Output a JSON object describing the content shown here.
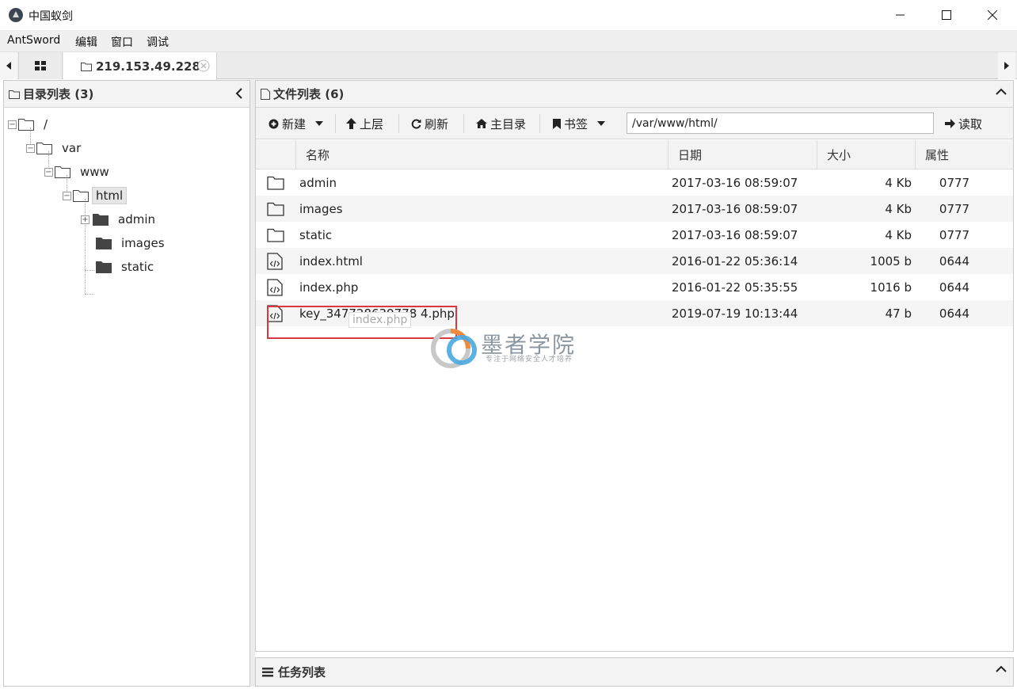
{
  "window": {
    "title": "中国蚁剑"
  },
  "menu": {
    "items": [
      "AntSword",
      "编辑",
      "窗口",
      "调试"
    ]
  },
  "tabs": {
    "active_label": "219.153.49.228"
  },
  "dir_panel": {
    "title": "目录列表 (3)",
    "tree": {
      "root": "/",
      "var": "var",
      "www": "www",
      "html": "html",
      "admin": "admin",
      "images": "images",
      "static": "static"
    }
  },
  "file_panel": {
    "title": "文件列表 (6)",
    "toolbar": {
      "new_label": "新建",
      "up_label": "上层",
      "refresh_label": "刷新",
      "home_label": "主目录",
      "bookmark_label": "书签",
      "path_value": "/var/www/html/",
      "read_label": "读取"
    },
    "columns": [
      "名称",
      "日期",
      "大小",
      "属性"
    ],
    "files": [
      {
        "name": "admin",
        "date": "2017-03-16 08:59:07",
        "size": "4 Kb",
        "attr": "0777",
        "type": "folder"
      },
      {
        "name": "images",
        "date": "2017-03-16 08:59:07",
        "size": "4 Kb",
        "attr": "0777",
        "type": "folder"
      },
      {
        "name": "static",
        "date": "2017-03-16 08:59:07",
        "size": "4 Kb",
        "attr": "0777",
        "type": "folder"
      },
      {
        "name": "index.html",
        "date": "2016-01-22 05:36:14",
        "size": "1005 b",
        "attr": "0644",
        "type": "code-file"
      },
      {
        "name": "index.php",
        "date": "2016-01-22 05:35:55",
        "size": "1016 b",
        "attr": "0644",
        "type": "code-file"
      },
      {
        "name": "key_347728639778 4.php",
        "date": "2019-07-19 10:13:44",
        "size": "47 b",
        "attr": "0644",
        "type": "code-file"
      }
    ],
    "tooltip": "index.php"
  },
  "watermark": {
    "title": "墨者学院",
    "subtitle": "专注于网络安全人才培养"
  },
  "task_panel": {
    "title": "任务列表"
  },
  "colors": {
    "highlight": "#d9383d",
    "watermark_orange": "#f08a3c",
    "watermark_blue": "#4aa8e0"
  }
}
